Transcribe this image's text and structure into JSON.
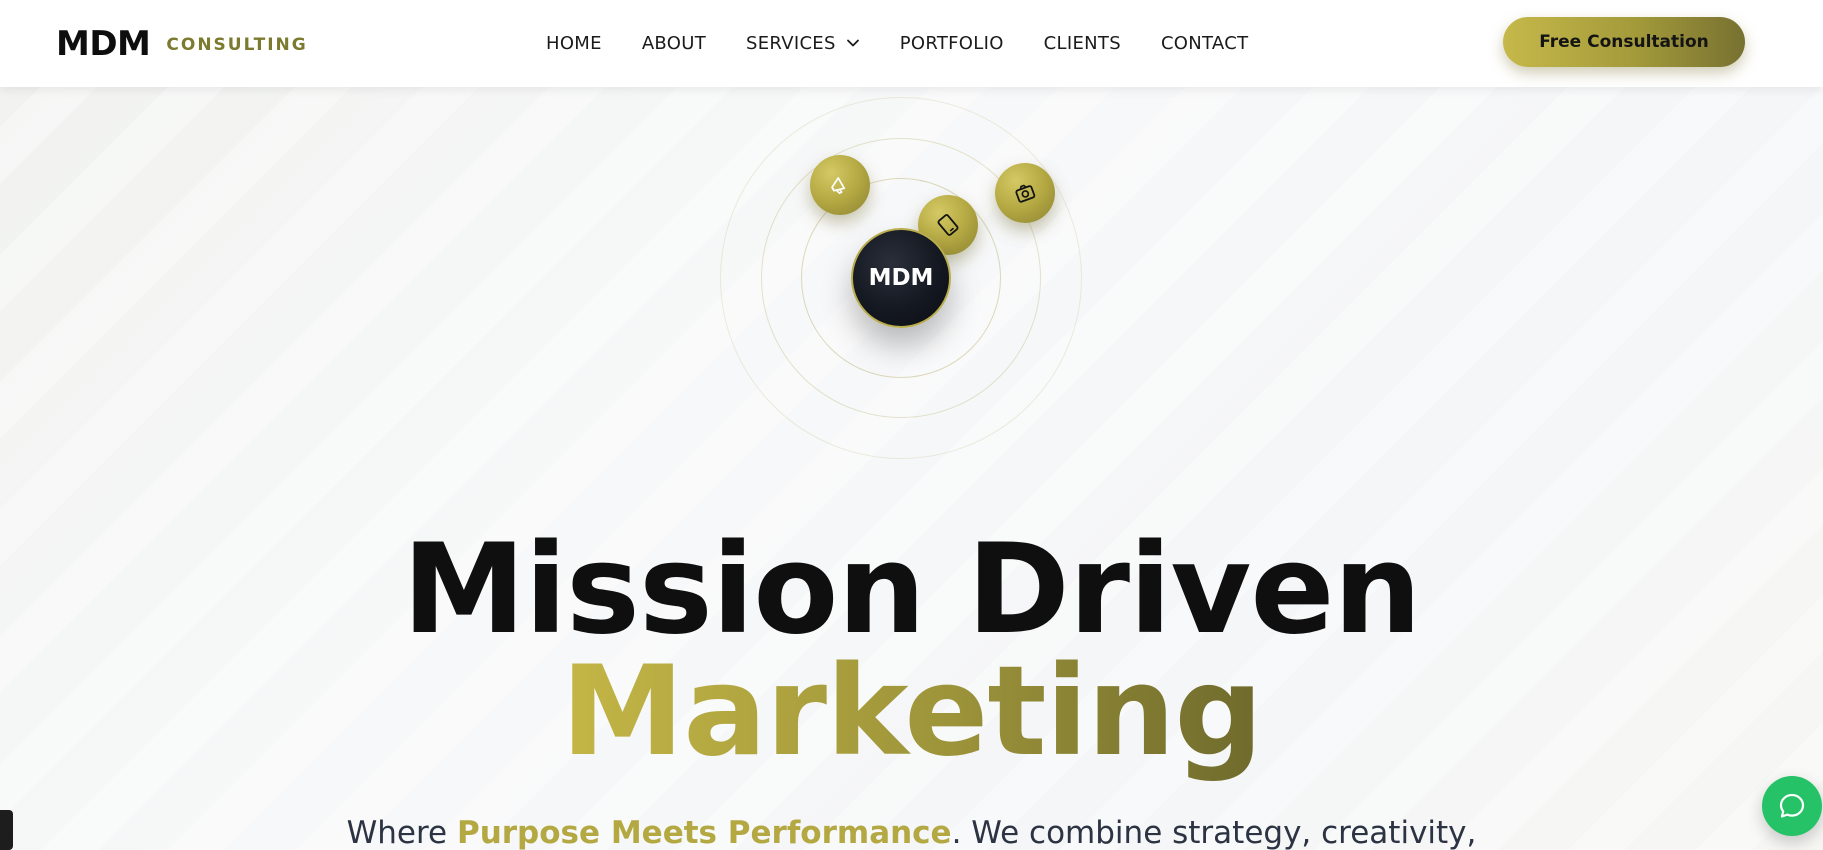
{
  "header": {
    "brand_main": "MDM",
    "brand_sub": "CONSULTING",
    "nav": [
      {
        "label": "HOME"
      },
      {
        "label": "ABOUT"
      },
      {
        "label": "SERVICES"
      },
      {
        "label": "PORTFOLIO"
      },
      {
        "label": "CLIENTS"
      },
      {
        "label": "CONTACT"
      }
    ],
    "cta_label": "Free Consultation"
  },
  "orbit": {
    "core_label": "MDM",
    "satellites": [
      {
        "icon": "megaphone-icon"
      },
      {
        "icon": "tablet-icon"
      },
      {
        "icon": "camera-icon"
      }
    ]
  },
  "hero": {
    "title_line1": "Mission Driven",
    "title_line2": "Marketing",
    "subtitle_pre": "Where ",
    "subtitle_highlight": "Purpose Meets Performance",
    "subtitle_post": ". We combine strategy, creativity,"
  },
  "colors": {
    "accent_gold": "#b4a842",
    "accent_gold_dark": "#777131",
    "dark": "#0f0f0f",
    "chat_green": "#25c267"
  }
}
